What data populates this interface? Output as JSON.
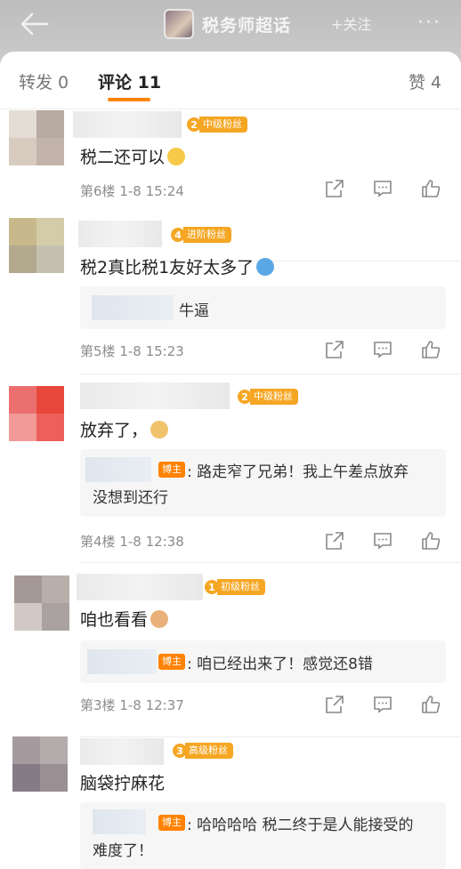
{
  "header": {
    "back_icon": "back-arrow-icon",
    "chip_title": "税务师超话",
    "follow_label": "+关注",
    "more_label": "···"
  },
  "tabs": {
    "repost": "转发 0",
    "comment": "评论 11",
    "like": "赞 4",
    "accent": "#ff8200"
  },
  "comments": [
    {
      "badge_level": "2",
      "badge_text": "中级粉丝",
      "badge_color": "#f5a623",
      "text": "税二还可以",
      "emoji": "hands-together-emoji",
      "floor": "第6楼",
      "time": "1-8 15:24"
    },
    {
      "badge_level": "4",
      "badge_text": "进阶粉丝",
      "badge_color": "#f5a623",
      "text": "税2真比税1友好太多了",
      "emoji": "shy-face-emoji",
      "reply": {
        "text": "牛逼"
      },
      "floor": "第5楼",
      "time": "1-8 15:23"
    },
    {
      "badge_level": "2",
      "badge_text": "中级粉丝",
      "badge_color": "#f5a623",
      "text": "放弃了，",
      "emoji": "doge-emoji",
      "reply": {
        "tag": "博主",
        "line1": "路走窄了兄弟！我上午差点放弃",
        "line2": "没想到还行"
      },
      "floor": "第4楼",
      "time": "1-8 12:38"
    },
    {
      "badge_level": "1",
      "badge_text": "初级粉丝",
      "badge_color": "#f5a623",
      "text": "咱也看看",
      "emoji": "cat-emoji",
      "reply": {
        "tag": "博主",
        "text": "咱已经出来了！感觉还8错"
      },
      "floor": "第3楼",
      "time": "1-8 12:37"
    },
    {
      "badge_level": "3",
      "badge_text": "高级粉丝",
      "badge_color": "#f5a623",
      "text": "脑袋拧麻花",
      "reply": {
        "tag": "博主",
        "line1": "哈哈哈哈 税二终于是人能接受的",
        "line2": "难度了！"
      }
    }
  ],
  "actions": {
    "share": "share-icon",
    "reply": "comment-icon",
    "like": "thumbs-up-icon"
  }
}
